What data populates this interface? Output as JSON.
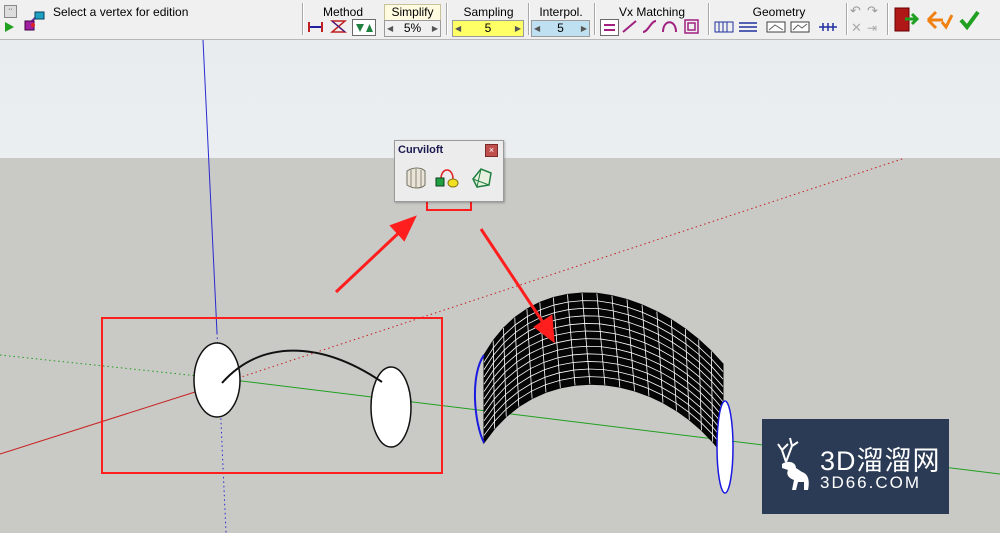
{
  "status_text": "Select a vertex for edition",
  "toolbar": {
    "method": {
      "label": "Method"
    },
    "simplify": {
      "label": "Simplify",
      "value": "5%"
    },
    "sampling": {
      "label": "Sampling",
      "value": "5"
    },
    "interpol": {
      "label": "Interpol.",
      "value": "5"
    },
    "vx_matching": {
      "label": "Vx Matching"
    },
    "geometry": {
      "label": "Geometry"
    }
  },
  "palette": {
    "title": "Curviloft"
  },
  "watermark": {
    "main": "3D溜溜网",
    "sub": "3D66.COM"
  },
  "colors": {
    "highlight_red": "#ff1e1e",
    "axis_blue": "#2a2ad0",
    "axis_red": "#c82020",
    "axis_green": "#20a020",
    "sampling_field": "#ffff66",
    "interpol_field": "#bfe0f0"
  }
}
